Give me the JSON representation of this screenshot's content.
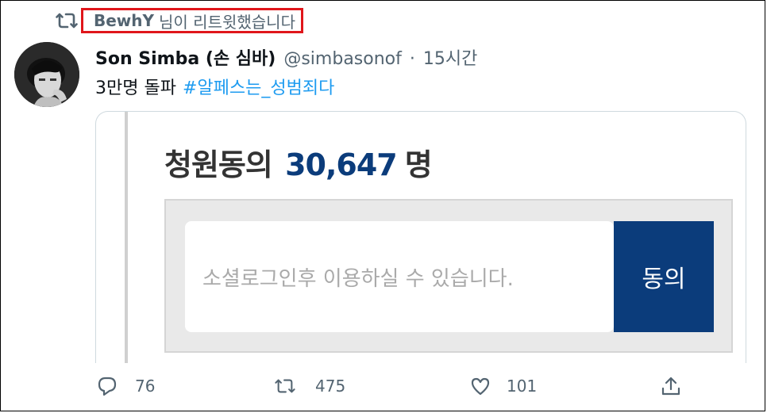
{
  "retweet": {
    "user": "BewhY",
    "suffix": "님이 리트윗했습니다"
  },
  "tweet": {
    "name": "Son Simba (손 심바)",
    "handle": "@simbasonof",
    "separator": "·",
    "time": "15시간",
    "text": "3만명 돌파",
    "hashtag": "#알페스는_성범죄다"
  },
  "card": {
    "title_prefix": "청원동의",
    "count": "30,647",
    "unit": "명",
    "login_placeholder": "소셜로그인후 이용하실 수 있습니다.",
    "agree_label": "동의"
  },
  "actions": {
    "replies": "76",
    "retweets": "475",
    "likes": "101"
  },
  "colors": {
    "accent": "#1d9bf0",
    "petition_blue": "#0b3c7b",
    "highlight_red": "#e0161b"
  },
  "icons": [
    "retweet-icon",
    "reply-icon",
    "like-icon",
    "share-icon"
  ]
}
